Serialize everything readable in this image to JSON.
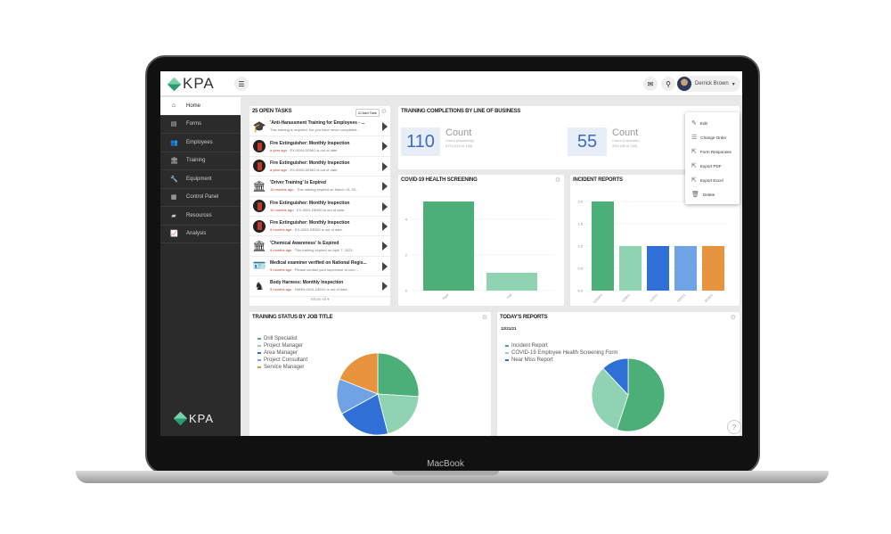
{
  "device": {
    "brand": "MacBook"
  },
  "header": {
    "logo": "KPA",
    "menu_icon": "hamburger-icon",
    "user_name": "Derrick Brown"
  },
  "sidebar": {
    "items": [
      {
        "label": "Home",
        "icon": "home-icon"
      },
      {
        "label": "Forms",
        "icon": "forms-icon"
      },
      {
        "label": "Employees",
        "icon": "employees-icon"
      },
      {
        "label": "Training",
        "icon": "training-icon"
      },
      {
        "label": "Equipment",
        "icon": "wrench-icon"
      },
      {
        "label": "Control Panel",
        "icon": "grid-icon"
      },
      {
        "label": "Resources",
        "icon": "resources-icon"
      },
      {
        "label": "Analysis",
        "icon": "chart-icon"
      }
    ],
    "logo": "KPA"
  },
  "tasks": {
    "title": "25 OPEN TASKS",
    "add_label": "Add Task",
    "show_all": "Show All ▾",
    "items": [
      {
        "title": "'Anti-Harassment Training for Employees - ...",
        "age": "",
        "detail": "This training is required, but you have never completed...",
        "icon": "graduation-cap-icon"
      },
      {
        "title": "Fire Extinguisher: Monthly Inspection",
        "age": "a year ago",
        "detail": " · EX-0004-DEMO is out of date.",
        "icon": "extinguisher-icon"
      },
      {
        "title": "Fire Extinguisher: Monthly Inspection",
        "age": "a year ago",
        "detail": " · EX-0002-DEMO is out of date.",
        "icon": "extinguisher-icon"
      },
      {
        "title": "'Driver Training' Is Expired",
        "age": "10 months ago",
        "detail": " · This training expired on March 15, 20...",
        "icon": "building-icon"
      },
      {
        "title": "Fire Extinguisher: Monthly Inspection",
        "age": "10 months ago",
        "detail": " · EX-0001-DEMO is out of date.",
        "icon": "extinguisher-icon"
      },
      {
        "title": "Fire Extinguisher: Monthly Inspection",
        "age": "9 months ago",
        "detail": " · EX-0003-DEMO is out of date.",
        "icon": "extinguisher-icon"
      },
      {
        "title": "'Chemical Awareness' Is Expired",
        "age": "9 months ago",
        "detail": " · This training expired on April 7, 2021.",
        "icon": "building-icon"
      },
      {
        "title": "Medical examiner verified on National Regis...",
        "age": "9 months ago",
        "detail": " · Please contact your supervisor to com...",
        "icon": "id-card-icon"
      },
      {
        "title": "Body Harness: Monthly Inspection",
        "age": "9 months ago",
        "detail": " · HARN-0015-DEMO is out of date.",
        "icon": "harness-icon"
      }
    ]
  },
  "completions": {
    "title": "TRAINING COMPLETIONS BY LINE OF BUSINESS",
    "cards": [
      {
        "value": "110",
        "label": "Count",
        "sub1": "Count (Assembly)",
        "sub2": "67% (110 of 165)"
      },
      {
        "value": "55",
        "label": "Count",
        "sub1": "Count (Concrete)",
        "sub2": "33% (55 of 165)"
      }
    ]
  },
  "context_menu": {
    "items": [
      {
        "label": "Edit",
        "icon": "edit-icon"
      },
      {
        "label": "Change Order",
        "icon": "reorder-icon"
      },
      {
        "label": "Form Responses",
        "icon": "external-icon"
      },
      {
        "label": "Export PDF",
        "icon": "external-icon"
      },
      {
        "label": "Export Excel",
        "icon": "external-icon"
      },
      {
        "label": "Delete",
        "icon": "trash-icon"
      }
    ]
  },
  "chart_data": [
    {
      "title": "COVID-19 HEALTH SCREENING",
      "type": "bar",
      "categories": [
        "Pass",
        "Fail"
      ],
      "values": [
        5,
        1
      ],
      "ylim": [
        0,
        5
      ],
      "yticks": [
        "0",
        "2",
        "4"
      ],
      "colors": [
        "#4caf78",
        "#8fd3b2"
      ]
    },
    {
      "title": "INCIDENT REPORTS",
      "type": "bar",
      "categories": [
        "12/20/21",
        "12/9/21",
        "11/2/21",
        "10/1/21",
        "9/14/21"
      ],
      "values": [
        2,
        1,
        1,
        1,
        1
      ],
      "ylim": [
        0,
        2
      ],
      "yticks": [
        "0.0",
        "0.5",
        "1.0",
        "1.5",
        "2.0"
      ],
      "colors": [
        "#4caf78",
        "#8fd3b2",
        "#2f6fd6",
        "#6fa3e6",
        "#e8943f"
      ]
    },
    {
      "title": "TRAINING STATUS BY JOB TITLE",
      "type": "pie",
      "legend": "top-left",
      "labels": [
        "Drill Specialist",
        "Project Manager",
        "Area Manager",
        "Project Consultant",
        "Service Manager"
      ],
      "values": [
        26,
        20,
        21,
        14,
        19
      ],
      "colors": [
        "#4caf78",
        "#8fd3b2",
        "#2f6fd6",
        "#6fa3e6",
        "#e8943f"
      ]
    },
    {
      "title": "TODAY'S REPORTS",
      "subtitle": "12/21/21",
      "type": "pie",
      "legend": "top-left",
      "labels": [
        "Incident Report",
        "COVID-19 Employee Health Screening Form",
        "Near Miss Report"
      ],
      "values": [
        55,
        33,
        12
      ],
      "colors": [
        "#4caf78",
        "#8fd3b2",
        "#2f6fd6"
      ]
    }
  ]
}
